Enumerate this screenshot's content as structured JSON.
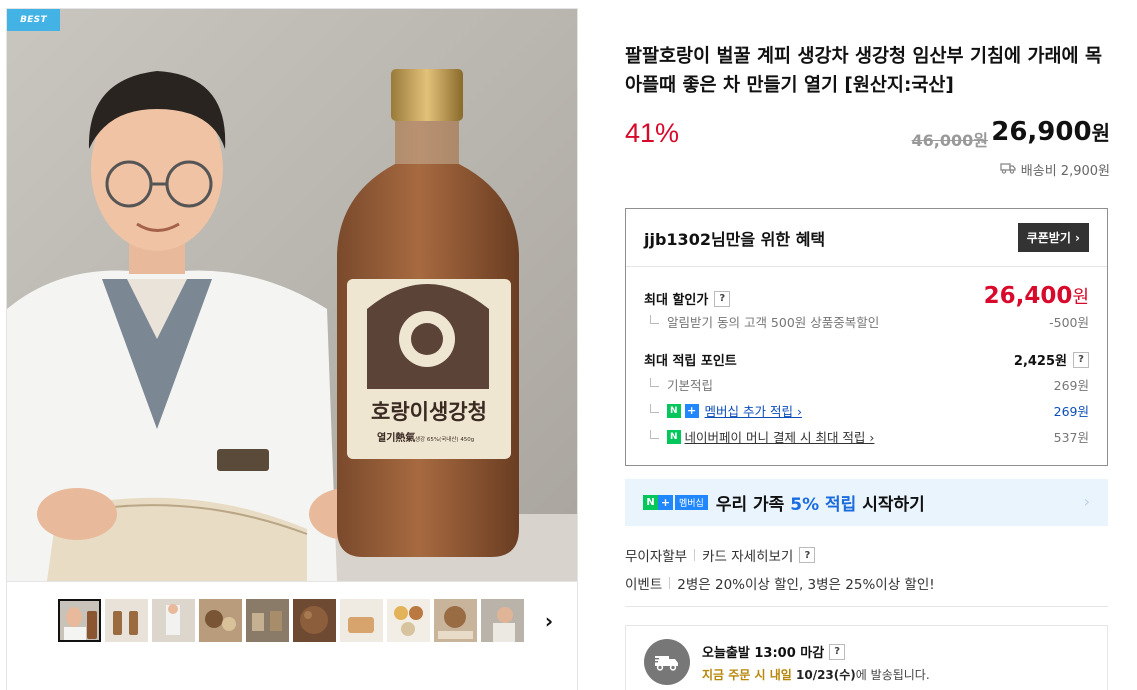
{
  "gallery": {
    "badge": "BEST",
    "bottle_label_main": "호랑이생강청",
    "bottle_label_sub": "열기熱氣",
    "bottle_label_small": "생강 65%(국내산) 450g",
    "thumbnail_count": 10,
    "selected_thumbnail": 1
  },
  "product": {
    "title": "팔팔호랑이 벌꿀 계피 생강차 생강청 임산부 기침에 가래에 목아플때 좋은 차 만들기 열기 [원산지:국산]",
    "discount_rate": "41%",
    "original_price": "46,000원",
    "sale_price": "26,900",
    "sale_price_unit": "원",
    "shipping": "배송비 2,900원"
  },
  "benefit": {
    "title": "jjb1302님만을 위한 혜택",
    "coupon_button": "쿠폰받기 ›",
    "max_discount_label": "최대 할인가",
    "max_discount_value": "26,400",
    "max_discount_unit": "원",
    "max_discount_detail": "알림받기 동의 고객 500원 상품중복할인",
    "max_discount_detail_value": "-500원",
    "max_point_label": "최대 적립 포인트",
    "max_point_value": "2,425원",
    "base_point_label": "기본적립",
    "base_point_value": "269원",
    "membership_point_label": "멤버십 추가 적립 ›",
    "membership_point_value": "269원",
    "npay_point_label": "네이버페이 머니 결제 시 최대 적립 ›",
    "npay_point_value": "537원",
    "help_mark": "?",
    "npay_n": "N",
    "npay_plus": "+"
  },
  "membership_banner": {
    "logo_text": "멤버십",
    "text_prefix": "우리 가족 ",
    "text_highlight": "5% 적립",
    "text_suffix": " 시작하기",
    "arrow": "›"
  },
  "payment": {
    "installment": "무이자할부",
    "card_detail": "카드 자세히보기",
    "event_label": "이벤트",
    "event_text": "2병은 20%이상 할인, 3병은 25%이상 할인!"
  },
  "delivery": {
    "cutoff": "오늘출발 13:00 마감",
    "notice_prefix": "지금 주문 시 내일 ",
    "notice_date": "10/23(수)",
    "notice_suffix": "에 발송됩니다."
  },
  "colors": {
    "discount_red": "#d8092b",
    "naver_green": "#03c75a",
    "membership_blue": "#2187ff",
    "badge_blue": "#43b3e5"
  }
}
